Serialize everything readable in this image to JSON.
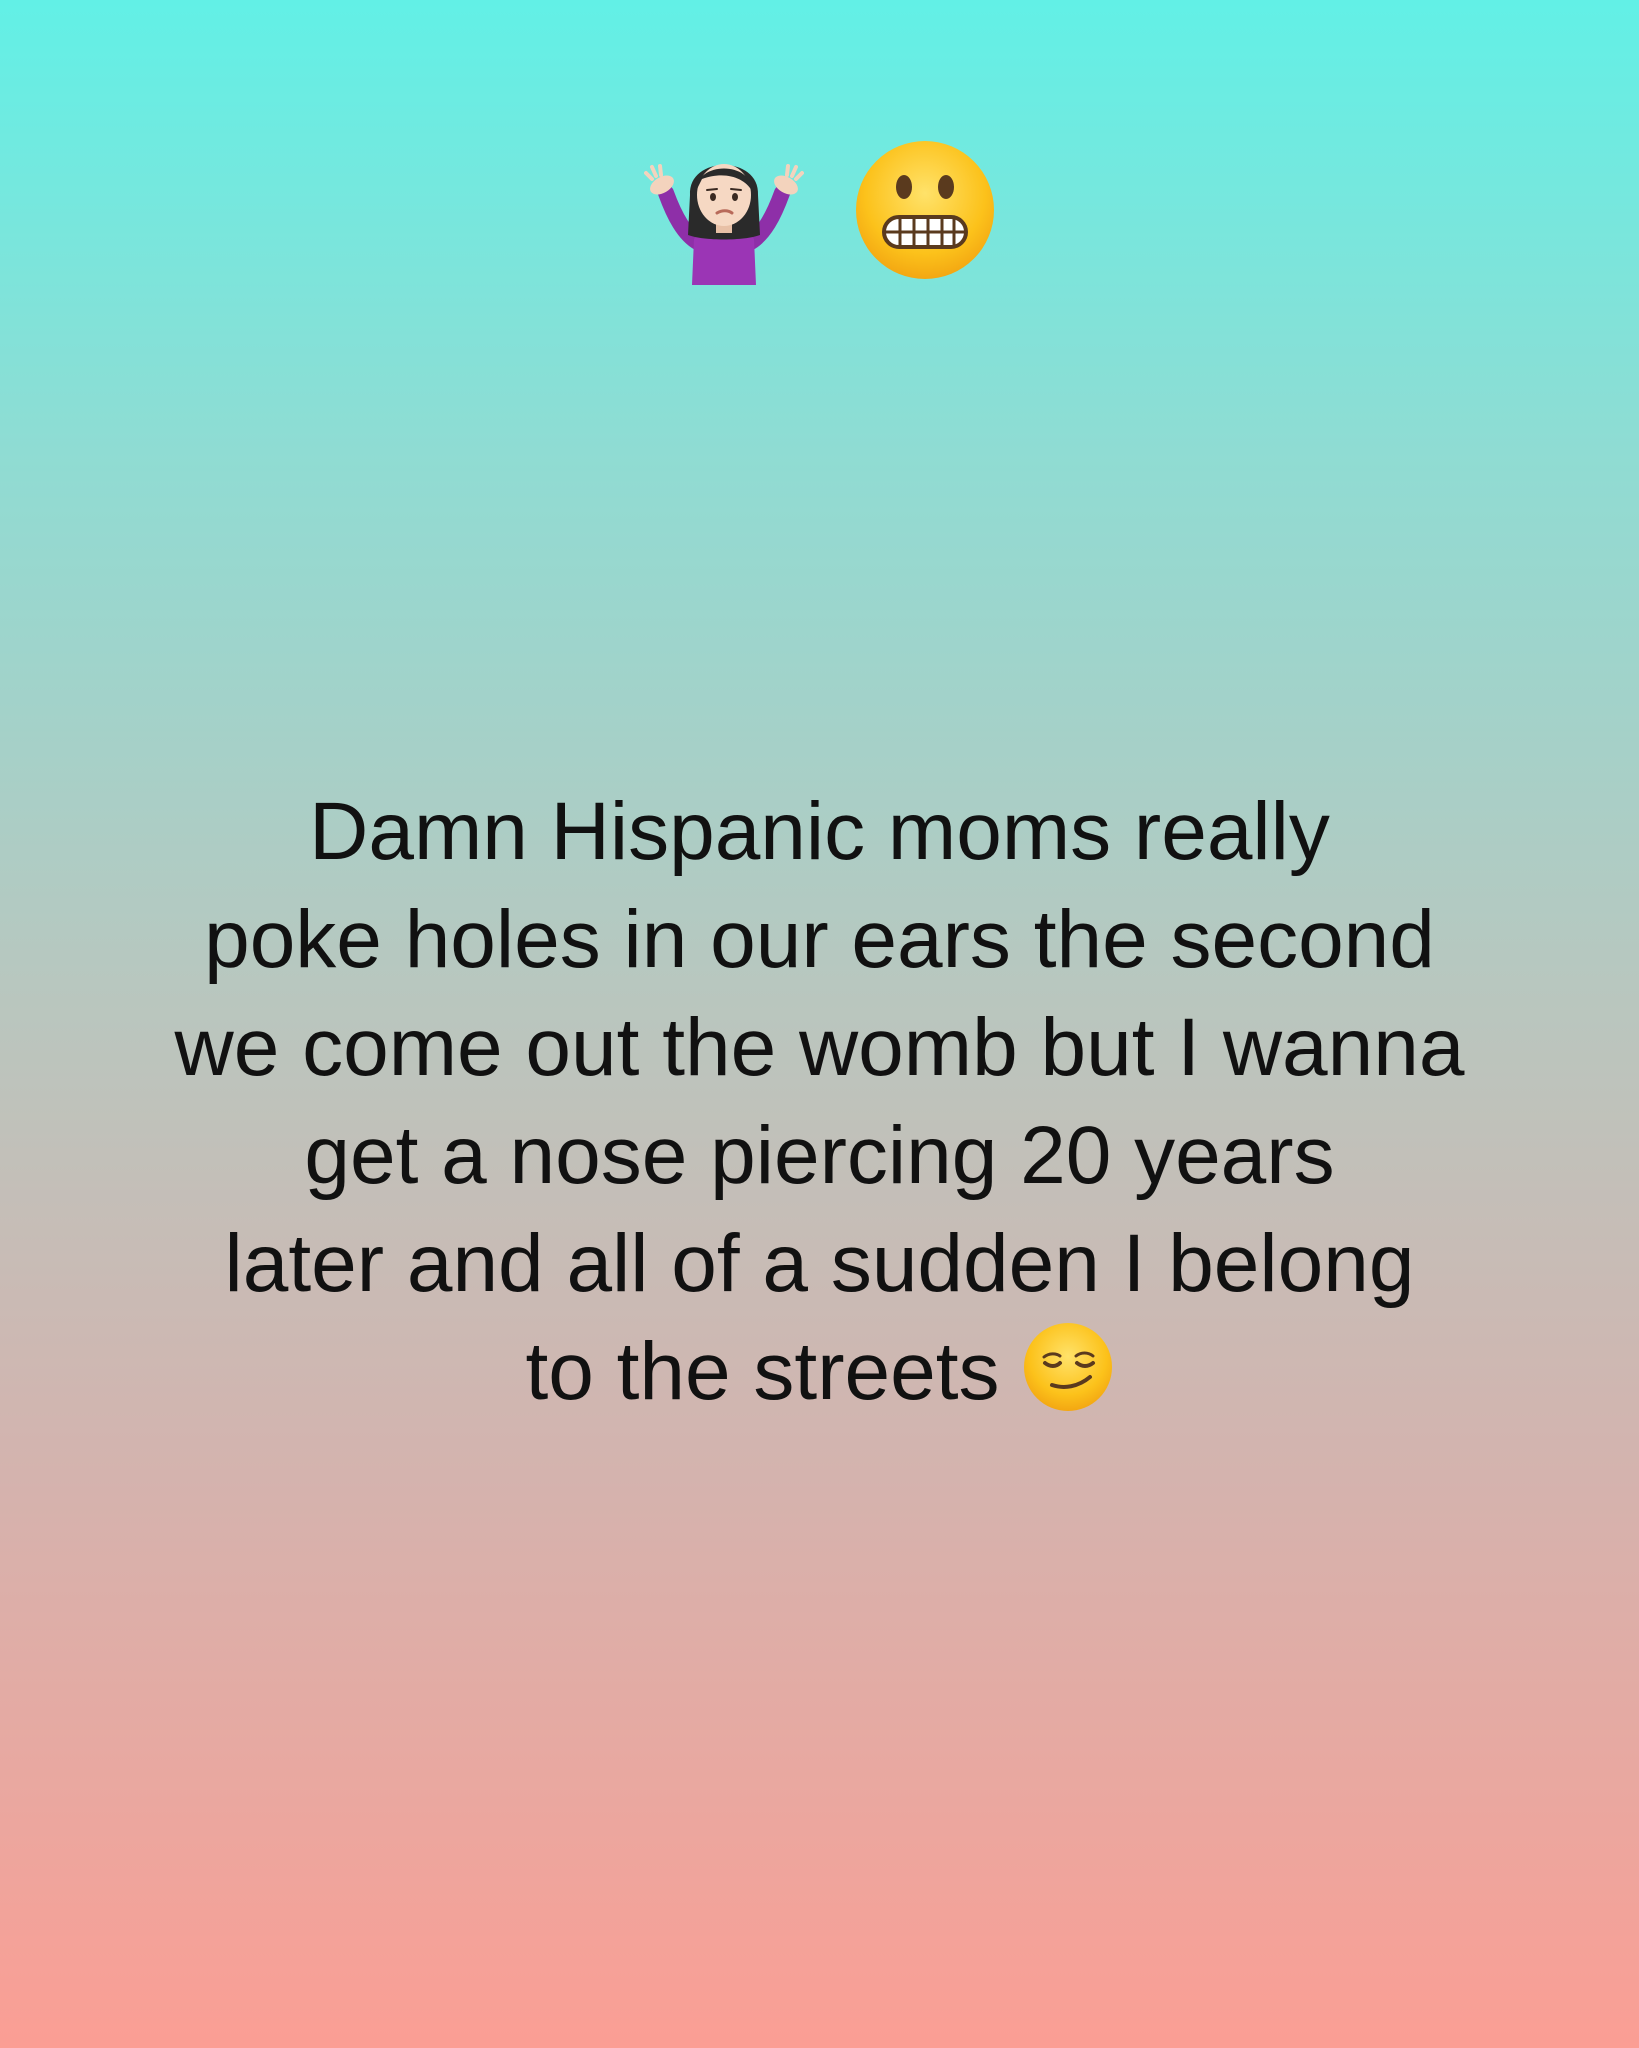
{
  "post": {
    "top_emojis": [
      {
        "icon": "woman-shrugging-emoji"
      },
      {
        "icon": "grimacing-face-emoji"
      }
    ],
    "lines": [
      "Damn Hispanic moms really",
      "poke holes in our ears the second",
      "we come out the womb but I wanna",
      "get a nose piercing 20 years",
      "later and all of a sudden I belong",
      "to the streets"
    ],
    "trailing_emoji": {
      "icon": "smirking-face-emoji"
    }
  },
  "colors": {
    "gradient_top": "#62f0e6",
    "gradient_bottom": "#fb9e94",
    "text": "#111111"
  }
}
